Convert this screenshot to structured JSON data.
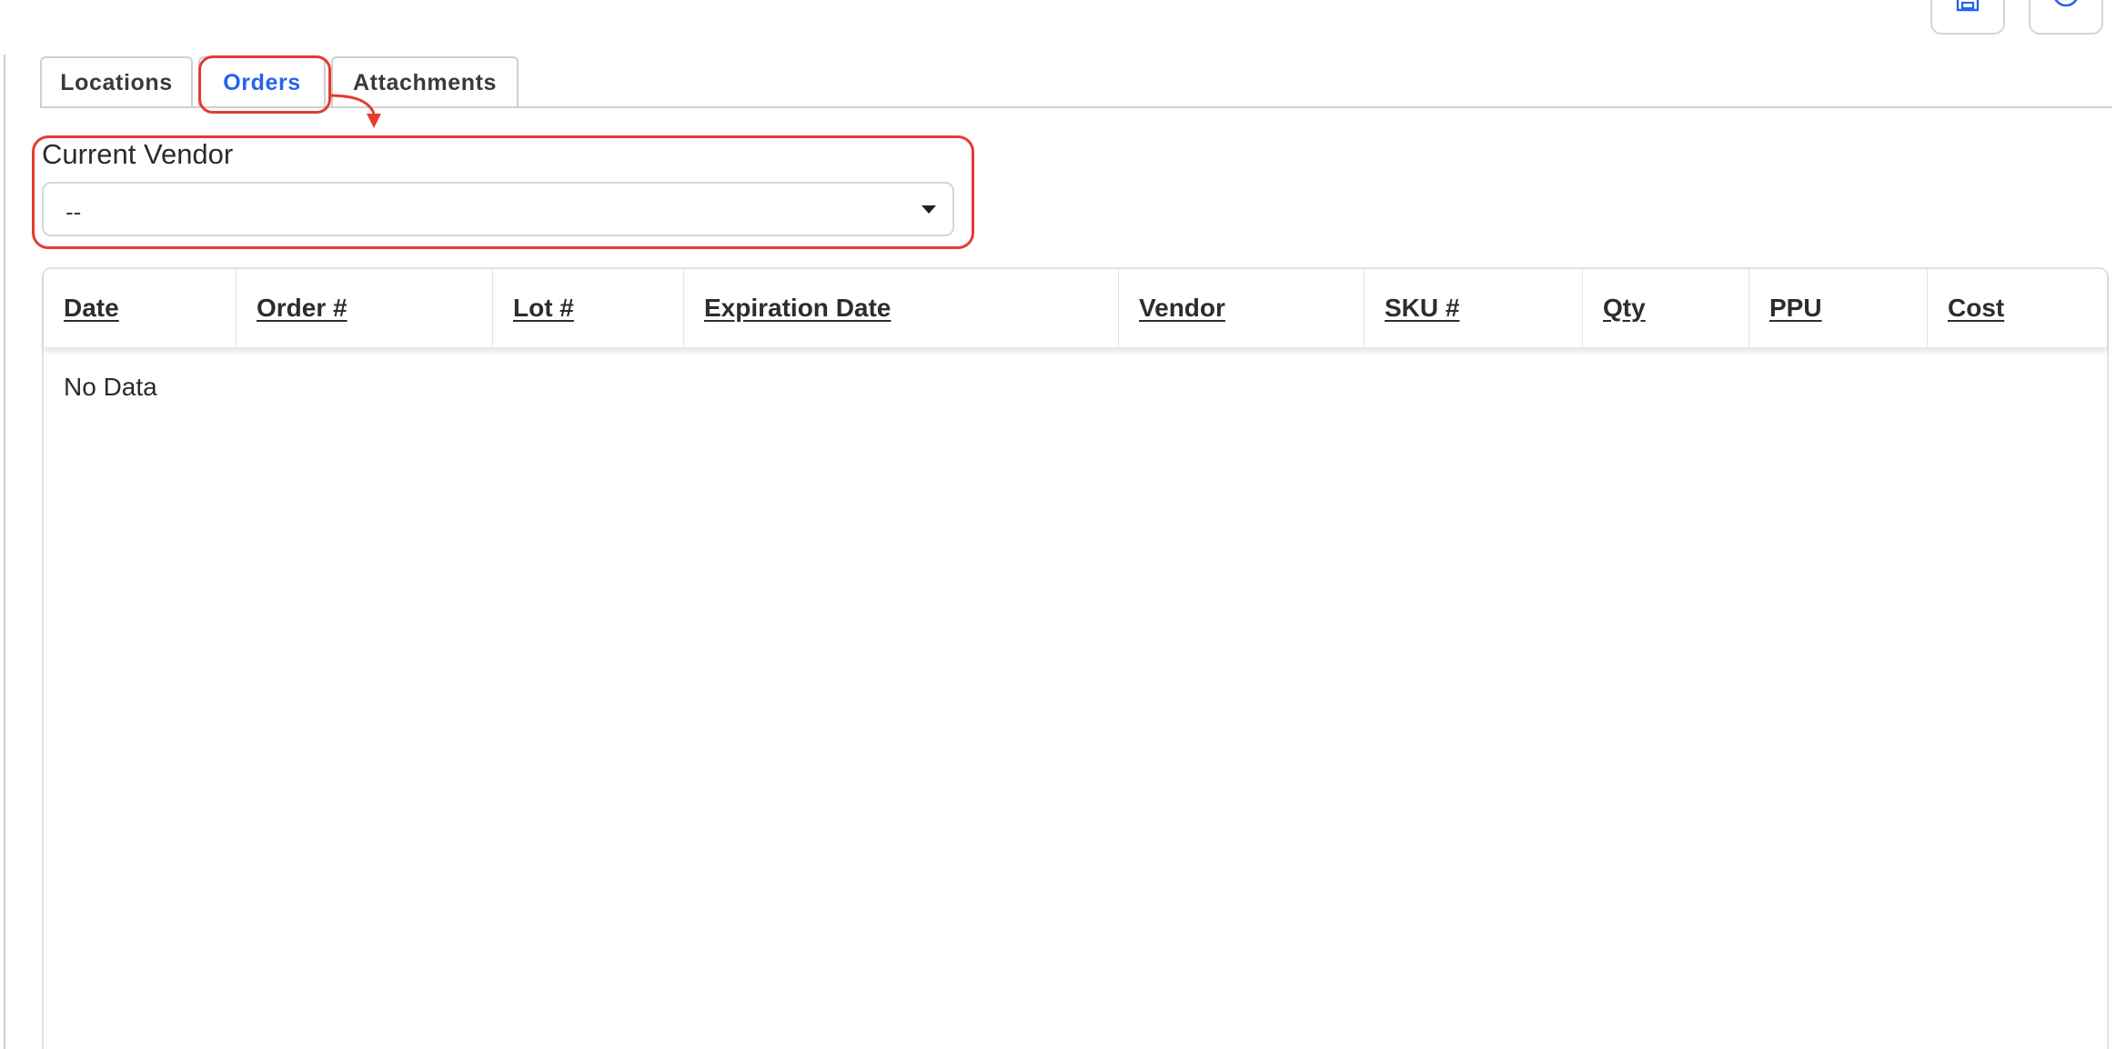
{
  "toolbar": {
    "save_icon": "save-icon",
    "cancel_icon": "close-circle-icon"
  },
  "tabs": [
    {
      "label": "Locations",
      "active": false
    },
    {
      "label": "Orders",
      "active": true
    },
    {
      "label": "Attachments",
      "active": false
    }
  ],
  "vendor": {
    "label": "Current Vendor",
    "value": "--"
  },
  "table": {
    "columns": [
      "Date",
      "Order #",
      "Lot #",
      "Expiration Date",
      "Vendor",
      "SKU #",
      "Qty",
      "PPU",
      "Cost"
    ],
    "empty_text": "No Data"
  },
  "colors": {
    "accent": "#2563eb",
    "annotation": "#e53b2e"
  }
}
